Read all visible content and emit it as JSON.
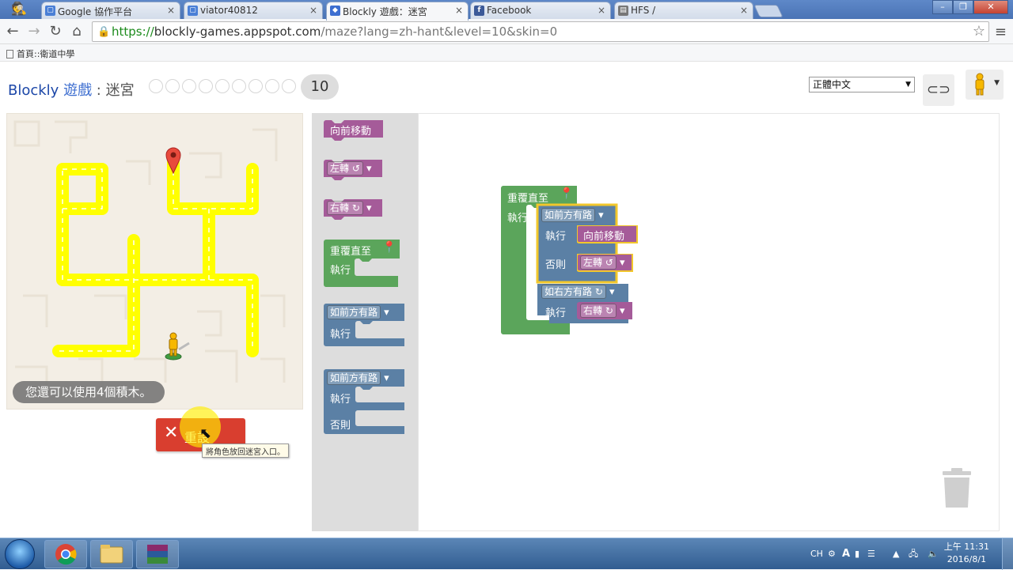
{
  "browser": {
    "tabs": [
      {
        "title": "Google 協作平台",
        "favicon": "google-sites-icon"
      },
      {
        "title": "viator40812",
        "favicon": "google-sites-icon"
      },
      {
        "title": "Blockly 遊戲：迷宮",
        "favicon": "blockly-icon"
      },
      {
        "title": "Facebook",
        "favicon": "facebook-icon"
      },
      {
        "title": "HFS /",
        "favicon": "hfs-icon"
      }
    ],
    "url": {
      "scheme": "https://",
      "host": "blockly-games.appspot.com",
      "path": "/maze?lang=zh-hant&level=10&skin=0"
    },
    "bookmark": "首頁::衛道中學",
    "tab_close": "×"
  },
  "page": {
    "title_blockly": "Blockly",
    "title_games": "遊戲",
    "title_sep": " : ",
    "title_maze": "迷宮",
    "level_dots": 9,
    "current_level": "10",
    "language": "正體中文"
  },
  "maze": {
    "blocks_remaining": "您還可以使用4個積木。",
    "reset_label": "重設",
    "reset_tooltip": "將角色放回迷宮入口。"
  },
  "toolbox": {
    "move_forward": "向前移動",
    "turn_left": "左轉 ↺",
    "turn_right": "右轉 ↻",
    "repeat_until": "重覆直至",
    "do_label": "執行",
    "if_path_ahead": "如前方有路",
    "else_label": "否則"
  },
  "workspace": {
    "repeat_until": "重覆直至",
    "do_label": "執行",
    "if_path_ahead": "如前方有路",
    "move_forward": "向前移動",
    "else_label": "否則",
    "turn_left": "左轉 ↺",
    "if_path_right": "如右方有路 ↻",
    "turn_right": "右轉 ↻"
  },
  "taskbar": {
    "lang": "CH",
    "time": "上午 11:31",
    "date": "2016/8/1"
  },
  "colors": {
    "motion": "#a55b99",
    "loop": "#5ba55b",
    "logic": "#5b80a5",
    "path": "#ffff00",
    "reset": "#d93e2f"
  }
}
